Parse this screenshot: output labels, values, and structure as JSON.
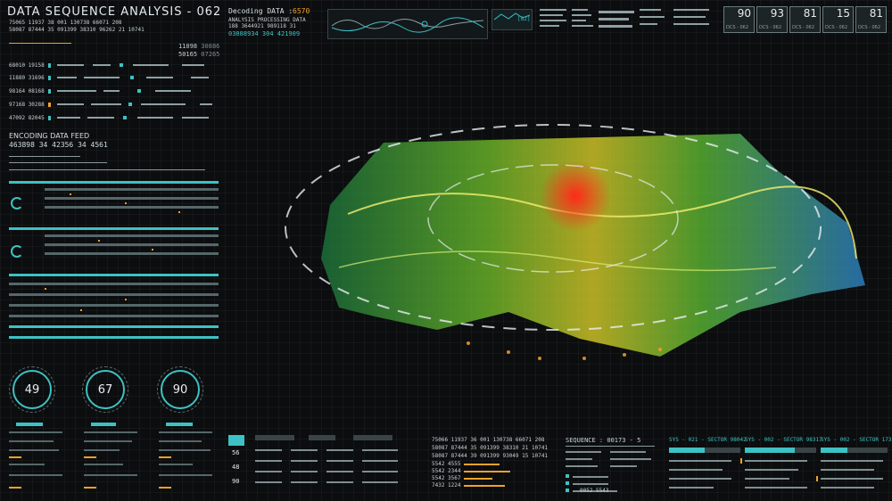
{
  "header": {
    "title": "DATA SEQUENCE ANALYSIS - 062",
    "num_row1": "75065 11937 38 001 130738 66071 208",
    "num_row2": "58087 87444 35 091399 38310 96262 21 10741",
    "decoding_label": "Decoding DATA :",
    "decoding_value": "6570",
    "analysis_label": "ANALYSIS PROCESSING DATA",
    "analysis_nums": "188 3644921 989118 31",
    "stream": "03888934 304 421909",
    "bracket_code": "[G2]"
  },
  "top_right_boxes": [
    {
      "value": "90",
      "label": "DCS - 062"
    },
    {
      "value": "93",
      "label": "DCS - 062"
    },
    {
      "value": "81",
      "label": "DCS - 062"
    },
    {
      "value": "15",
      "label": "DCS - 062"
    },
    {
      "value": "81",
      "label": "DCS - 062"
    }
  ],
  "left_panel": {
    "pair1": "11098",
    "pair1b": "30886",
    "pair2": "50165",
    "pair2b": "07265",
    "rows": [
      {
        "a": "68010",
        "b": "19158"
      },
      {
        "a": "11880",
        "b": "31696"
      },
      {
        "a": "98164",
        "b": "08168"
      },
      {
        "a": "97168",
        "b": "30288"
      },
      {
        "a": "47092",
        "b": "82045"
      }
    ],
    "feed_title": "ENCODING DATA FEED",
    "feed_nums": "463898 34 42356 34 4561",
    "gauges": [
      {
        "value": "49"
      },
      {
        "value": "67"
      },
      {
        "value": "90"
      }
    ]
  },
  "bottom": {
    "sequence_label": "SEQUENCE : 00173 - 5",
    "row_label": "0052 5543",
    "sys_labels": [
      "SYS - 021 - SECTOR 98042",
      "SYS - 002 - SECTOR 98317",
      "SYS - 002 - SECTOR 17339"
    ],
    "box_values": [
      "56",
      "48",
      "90"
    ],
    "mid_nums1": "75066 11937 36 001 130738 66071 208",
    "mid_nums2": "58087 87444 35 091399 38310 21 10741",
    "mid_nums3": "58087 87444 39 091399 93049 15 10741",
    "mid_rows": [
      "5542 4555",
      "5542 2344",
      "5542 3567",
      "7432 1224"
    ]
  },
  "colors": {
    "accent": "#3ec1c4",
    "highlight": "#f0a22a",
    "background": "#0b0d0e"
  }
}
